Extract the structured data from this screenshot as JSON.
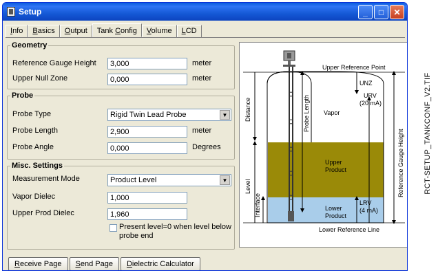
{
  "window": {
    "title": "Setup"
  },
  "tabs": [
    {
      "prefix": "",
      "accel": "I",
      "rest": "nfo"
    },
    {
      "prefix": "",
      "accel": "B",
      "rest": "asics"
    },
    {
      "prefix": "",
      "accel": "O",
      "rest": "utput"
    },
    {
      "prefix": "Tank ",
      "accel": "C",
      "rest": "onfig"
    },
    {
      "prefix": "",
      "accel": "V",
      "rest": "olume"
    },
    {
      "prefix": "",
      "accel": "L",
      "rest": "CD"
    }
  ],
  "geometry": {
    "legend": "Geometry",
    "ref_gauge_label": "Reference Gauge Height",
    "ref_gauge_value": "3,000",
    "ref_gauge_unit": "meter",
    "upper_null_label": "Upper Null Zone",
    "upper_null_value": "0,000",
    "upper_null_unit": "meter"
  },
  "probe": {
    "legend": "Probe",
    "type_label": "Probe Type",
    "type_value": "Rigid Twin Lead Probe",
    "length_label": "Probe Length",
    "length_value": "2,900",
    "length_unit": "meter",
    "angle_label": "Probe Angle",
    "angle_value": "0,000",
    "angle_unit": "Degrees"
  },
  "misc": {
    "legend": "Misc. Settings",
    "mode_label": "Measurement Mode",
    "mode_value": "Product Level",
    "vapor_label": "Vapor Dielec",
    "vapor_value": "1,000",
    "upper_label": "Upper Prod Dielec",
    "upper_value": "1,960",
    "checkbox_line1": "Present level=0 when level below",
    "checkbox_line2": "probe end",
    "checkbox_checked": false
  },
  "diagram": {
    "upper_ref": "Upper Reference Point",
    "unz": "UNZ",
    "urv": "URV",
    "urv_ma": "(20 mA)",
    "distance": "Distance",
    "probe_length": "Probe Length",
    "vapor": "Vapor",
    "ref_gauge": "Reference Gauge Height",
    "upper_product_1": "Upper",
    "upper_product_2": "Product",
    "level": "Level",
    "interface": "Interface",
    "lower_product_1": "Lower",
    "lower_product_2": "Product",
    "lrv": "LRV",
    "lrv_ma": "(4 mA)",
    "lower_ref": "Lower Reference Line",
    "colors": {
      "upper_product": "#9a8a08",
      "lower_product": "#a9cdea"
    }
  },
  "buttons": [
    {
      "accel": "R",
      "rest": "eceive Page"
    },
    {
      "accel": "S",
      "rest": "end Page"
    },
    {
      "accel": "D",
      "rest": "ielectric Calculator"
    }
  ],
  "side_caption": "RCT-SETUP_TANKCONF_V2.TIF"
}
